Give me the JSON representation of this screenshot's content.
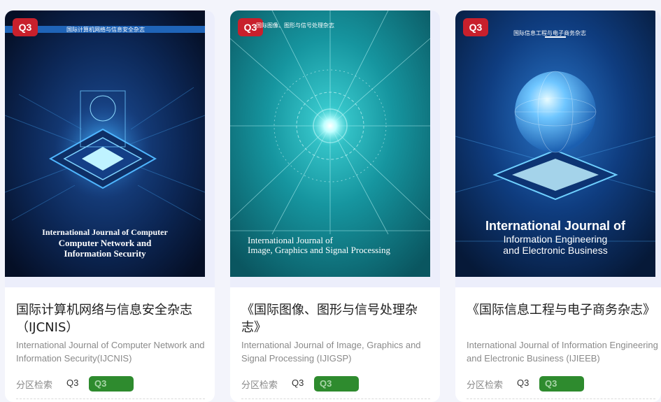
{
  "journals": [
    {
      "badge": "Q3",
      "cover_title_cn": "国际计算机网络与信息安全杂志",
      "cover_en_line1": "International Journal of Computer",
      "cover_en_line2": "Computer Network and",
      "cover_en_line3": "Information Security",
      "title_cn": "国际计算机网络与信息安全杂志（IJCNIS）",
      "title_en": "International Journal of Computer Network and Information Security(IJCNIS)",
      "meta_label": "分区检索",
      "meta_value": "Q3",
      "meta_pill": "Q3"
    },
    {
      "badge": "Q3",
      "cover_title_cn": "国际图像、图形与信号处理杂志",
      "cover_en_line1": "International Journal of",
      "cover_en_line2": "Image, Graphics and Signal Processing",
      "title_cn": "《国际图像、图形与信号处理杂志》",
      "title_en": "International Journal of Image, Graphics and Signal Processing (IJIGSP)",
      "meta_label": "分区检索",
      "meta_value": "Q3",
      "meta_pill": "Q3"
    },
    {
      "badge": "Q3",
      "cover_title_cn": "国际信息工程与电子商务杂志",
      "cover_en_line1": "International Journal of",
      "cover_en_line2": "Information Engineering",
      "cover_en_line3": "and Electronic Business",
      "title_cn": "《国际信息工程与电子商务杂志》",
      "title_en": "International Journal of Information Engineering and Electronic Business (IJIEEB)",
      "meta_label": "分区检索",
      "meta_value": "Q3",
      "meta_pill": "Q3"
    }
  ],
  "colors": {
    "badge_red": "#c8202c",
    "pill_green": "#2e8b2e",
    "cover1_bg": "#0a1f45",
    "cover2_bg": "#127a86",
    "cover3_bg": "#0b2a5c"
  },
  "icons": [
    "chip-globe-illustration",
    "radial-burst-illustration",
    "globe-chip-illustration"
  ]
}
